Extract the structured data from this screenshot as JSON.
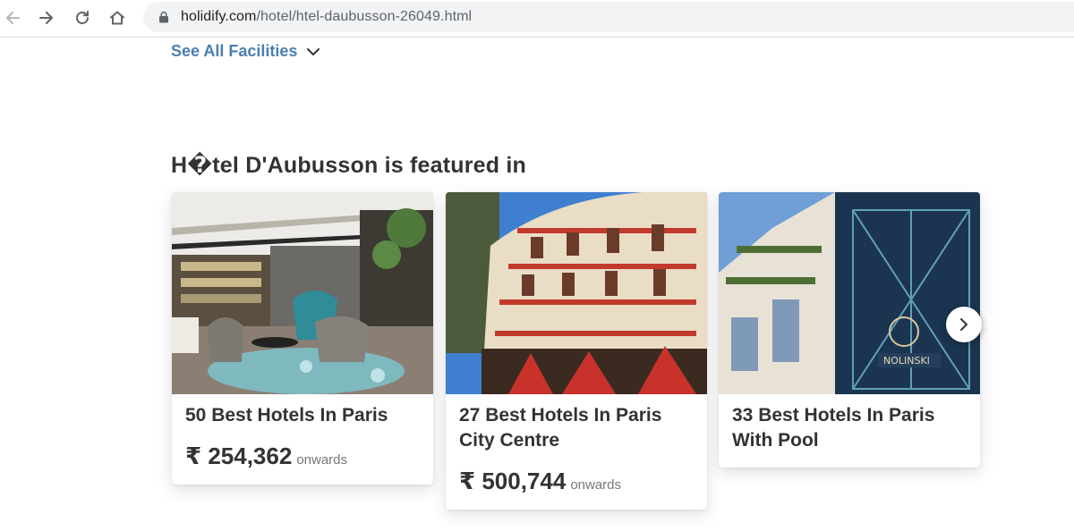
{
  "browser": {
    "url_host": "holidify.com",
    "url_path": "/hotel/htel-daubusson-26049.html"
  },
  "facilities": {
    "see_all_label": "See All Facilities"
  },
  "featured": {
    "title": "H�tel D'Aubusson is featured in",
    "cards": [
      {
        "title": "50 Best Hotels In Paris",
        "price": "₹ 254,362",
        "price_suffix": "onwards",
        "image": "hotel-lounge-interior"
      },
      {
        "title": "27 Best Hotels In Paris City Centre",
        "price": "₹ 500,744",
        "price_suffix": "onwards",
        "image": "parisian-building-facade"
      },
      {
        "title": "33 Best Hotels In Paris With Pool",
        "price": "",
        "price_suffix": "",
        "image": "nolinski-hotel-entrance"
      }
    ]
  },
  "icons": {
    "back": "arrow-left-icon",
    "forward": "arrow-right-icon",
    "reload": "reload-icon",
    "home": "home-icon",
    "lock": "lock-icon",
    "chevron": "chevron-down-icon",
    "next": "chevron-right-icon"
  },
  "colors": {
    "link": "#4a7fb0",
    "text": "#333333",
    "muted": "#777777",
    "url_bar": "#f1f3f4"
  }
}
